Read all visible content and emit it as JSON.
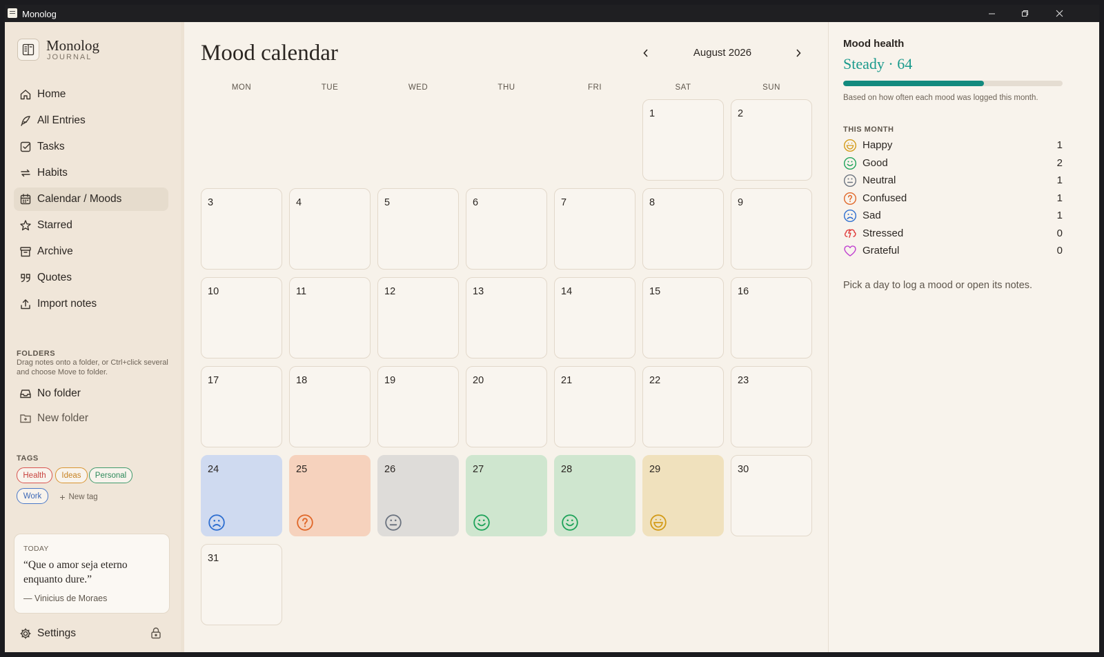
{
  "window": {
    "title": "Monolog",
    "controls": [
      "minimize-icon",
      "restore-icon",
      "close-icon"
    ]
  },
  "sidebar": {
    "brand": {
      "name": "Monolog",
      "subtitle": "JOURNAL"
    },
    "nav": [
      {
        "label": "Home",
        "icon": "home-icon"
      },
      {
        "label": "All Entries",
        "icon": "feather-icon"
      },
      {
        "label": "Tasks",
        "icon": "checkbox-icon"
      },
      {
        "label": "Habits",
        "icon": "repeat-icon"
      },
      {
        "label": "Calendar / Moods",
        "icon": "calendar-icon",
        "active": true
      },
      {
        "label": "Starred",
        "icon": "star-icon"
      },
      {
        "label": "Archive",
        "icon": "archive-icon"
      },
      {
        "label": "Quotes",
        "icon": "quote-icon"
      },
      {
        "label": "Import notes",
        "icon": "upload-icon"
      }
    ],
    "folders": {
      "heading": "FOLDERS",
      "hint": "Drag notes onto a folder, or Ctrl+click several and choose Move to folder.",
      "items": [
        {
          "label": "No folder",
          "icon": "inbox-icon"
        },
        {
          "label": "New folder",
          "icon": "folder-plus-icon"
        }
      ]
    },
    "tags": {
      "heading": "TAGS",
      "items": [
        {
          "label": "Health",
          "color": "#d9534f"
        },
        {
          "label": "Ideas",
          "color": "#d9942f"
        },
        {
          "label": "Personal",
          "color": "#3f9a6b"
        },
        {
          "label": "Work",
          "color": "#4a78c8"
        }
      ],
      "new_tag_label": "New tag"
    },
    "quote": {
      "label": "TODAY",
      "text": "“Que o amor seja eterno enquanto dure.”",
      "author": "— Vinicius de Moraes"
    },
    "settings_label": "Settings"
  },
  "calendar": {
    "title": "Mood calendar",
    "month_label": "August 2026",
    "weekdays": [
      "MON",
      "TUE",
      "WED",
      "THU",
      "FRI",
      "SAT",
      "SUN"
    ],
    "first_weekday_index": 5,
    "days_in_month": 31,
    "moods_by_day": {
      "24": "sad",
      "25": "confused",
      "26": "neutral",
      "27": "good",
      "28": "good",
      "29": "happy"
    }
  },
  "moods": {
    "happy": {
      "label": "Happy",
      "color": "#d39b18",
      "bg": "#f0e1bd"
    },
    "good": {
      "label": "Good",
      "color": "#1fa35a",
      "bg": "#cfe6cf"
    },
    "neutral": {
      "label": "Neutral",
      "color": "#6c7480",
      "bg": "#dedcd9"
    },
    "confused": {
      "label": "Confused",
      "color": "#e0682a",
      "bg": "#f6d2bd"
    },
    "sad": {
      "label": "Sad",
      "color": "#2f6fd0",
      "bg": "#cfdaf0"
    },
    "stressed": {
      "label": "Stressed",
      "color": "#e03a3a",
      "bg": "#f6d0d0"
    },
    "grateful": {
      "label": "Grateful",
      "color": "#c040d0",
      "bg": "#efd3f2"
    }
  },
  "right_panel": {
    "title": "Mood health",
    "health_label": "Steady · 64",
    "health_fraction": 0.64,
    "note": "Based on how often each mood was logged this month.",
    "section": "THIS MONTH",
    "counts": [
      {
        "key": "happy",
        "label": "Happy",
        "count": "1"
      },
      {
        "key": "good",
        "label": "Good",
        "count": "2"
      },
      {
        "key": "neutral",
        "label": "Neutral",
        "count": "1"
      },
      {
        "key": "confused",
        "label": "Confused",
        "count": "1"
      },
      {
        "key": "sad",
        "label": "Sad",
        "count": "1"
      },
      {
        "key": "stressed",
        "label": "Stressed",
        "count": "0"
      },
      {
        "key": "grateful",
        "label": "Grateful",
        "count": "0"
      }
    ],
    "hint": "Pick a day to log a mood or open its notes."
  }
}
